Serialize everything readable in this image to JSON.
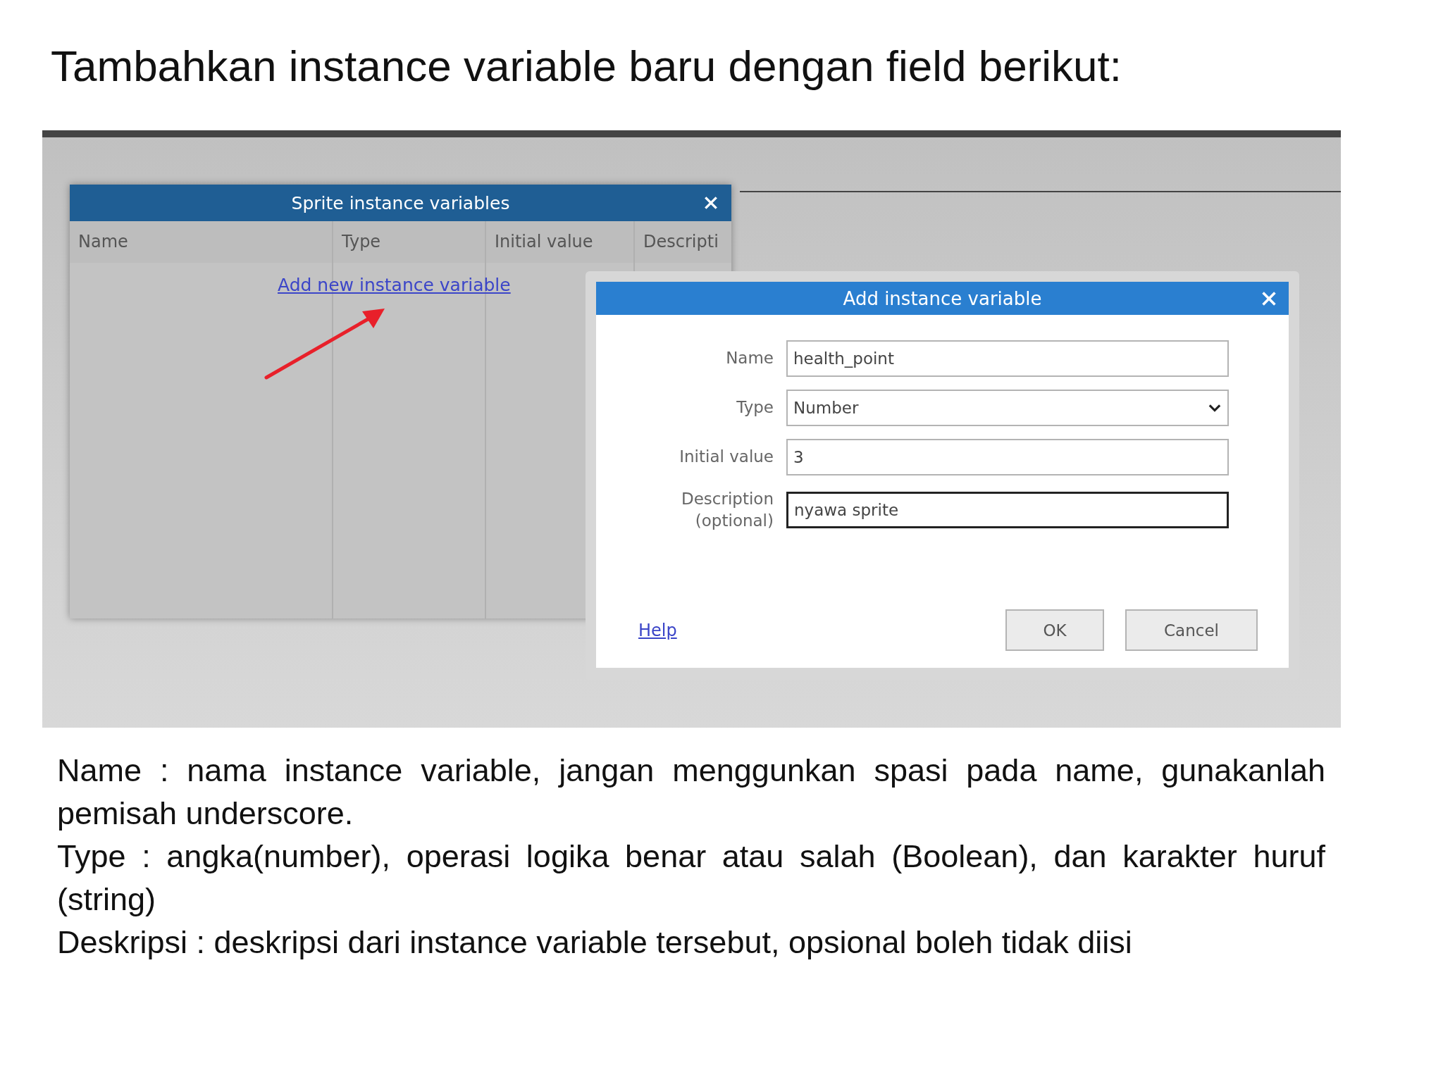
{
  "slide_title": "Tambahkan instance variable baru dengan field berikut:",
  "screenshot": {
    "list_dialog": {
      "title": "Sprite instance variables",
      "columns": [
        "Name",
        "Type",
        "Initial value",
        "Descripti"
      ],
      "add_link": "Add new instance variable"
    },
    "add_dialog": {
      "title": "Add instance variable",
      "fields": [
        {
          "kind": "text",
          "label": "Name",
          "value": "health_point",
          "focused": false
        },
        {
          "kind": "select",
          "label": "Type",
          "value": "Number",
          "focused": false
        },
        {
          "kind": "text",
          "label": "Initial value",
          "value": "3",
          "focused": false
        },
        {
          "kind": "text",
          "label": "Description (optional)",
          "value": "nyawa sprite",
          "focused": true
        }
      ],
      "help": "Help",
      "buttons": [
        "OK",
        "Cancel"
      ]
    }
  },
  "notes": [
    "Name : nama instance variable, jangan menggunkan spasi pada name, gunakanlah pemisah underscore.",
    "Type : angka(number), operasi logika benar atau salah (Boolean), dan karakter huruf (string)",
    "Deskripsi : deskripsi dari instance variable tersebut, opsional boleh tidak diisi"
  ]
}
